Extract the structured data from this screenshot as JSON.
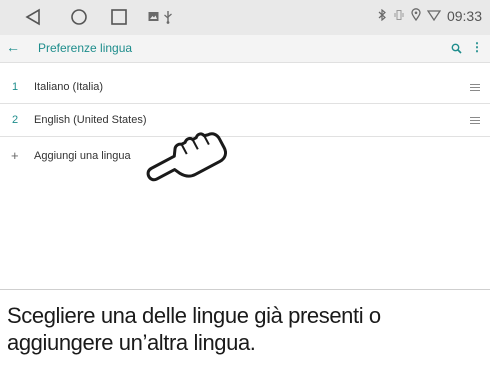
{
  "statusbar": {
    "nav_icons": [
      "back-triangle-icon",
      "home-circle-icon",
      "recent-apps-square-icon"
    ],
    "notification_icons": [
      "image-icon",
      "usb-icon"
    ],
    "system_icons": [
      "bluetooth-icon",
      "vibrate-icon",
      "location-icon",
      "wifi-icon"
    ],
    "time": "09:33"
  },
  "appbar": {
    "back_icon": "arrow-left-icon",
    "title": "Preferenze lingua",
    "search_icon": "search-icon",
    "more_icon": "more-vert-icon",
    "accent_color": "#1e8d8c"
  },
  "languages": [
    {
      "number": "1",
      "label": "Italiano (Italia)"
    },
    {
      "number": "2",
      "label": "English (United States)"
    }
  ],
  "add_language": {
    "icon": "+",
    "label": "Aggiungi una lingua"
  },
  "caption": "Scegliere una delle lingue già presenti o aggiungere un’altra lingua."
}
